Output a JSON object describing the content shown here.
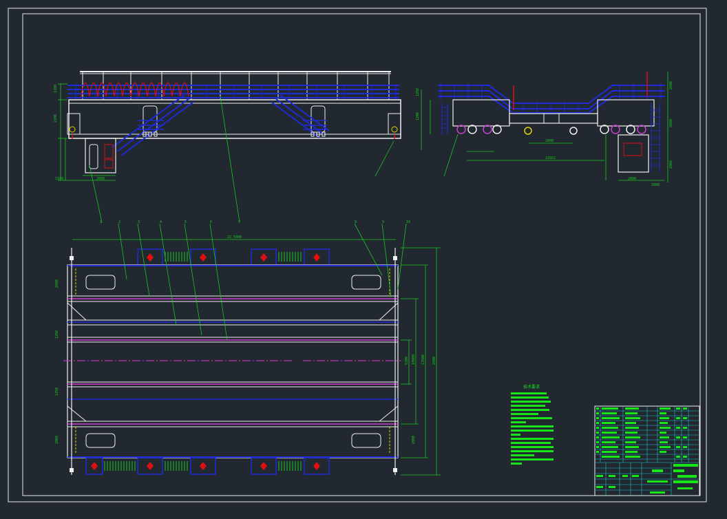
{
  "drawing": {
    "background": "#212830",
    "colors": {
      "frame": "#e6e6e6",
      "steel": "#f0f0f0",
      "rail": "#1f2bd6",
      "dim": "#19c81e",
      "center": "#d23cd2",
      "accent_red": "#e01010",
      "accent_yellow": "#e6d200",
      "titleblock": "#19e619",
      "titleblock_cyan": "#19c8c8"
    }
  },
  "dims": {
    "span_top": "22.5000",
    "width_top": "2000",
    "gauge_side": "2000",
    "wheelbase_side": "11022",
    "plan_h1": "2000",
    "plan_h2": "1250",
    "plan_h3": "5300",
    "plan_h4": "10000",
    "plan_h5": "13500",
    "plan_h6": "2000",
    "left_v1": "1100",
    "left_v2": "2100",
    "left_v3": "1100",
    "right_v1": "2000",
    "right_v2": "2000",
    "right_v3": "2000",
    "side_small1": "1250",
    "side_small2": "1200",
    "side_bottom1": "2000",
    "side_bottom2": "2000"
  },
  "leaders": [
    "1",
    "2",
    "3",
    "4",
    "5",
    "6",
    "7",
    "8",
    "9",
    "10"
  ],
  "notes": {
    "title": "技术要求"
  }
}
